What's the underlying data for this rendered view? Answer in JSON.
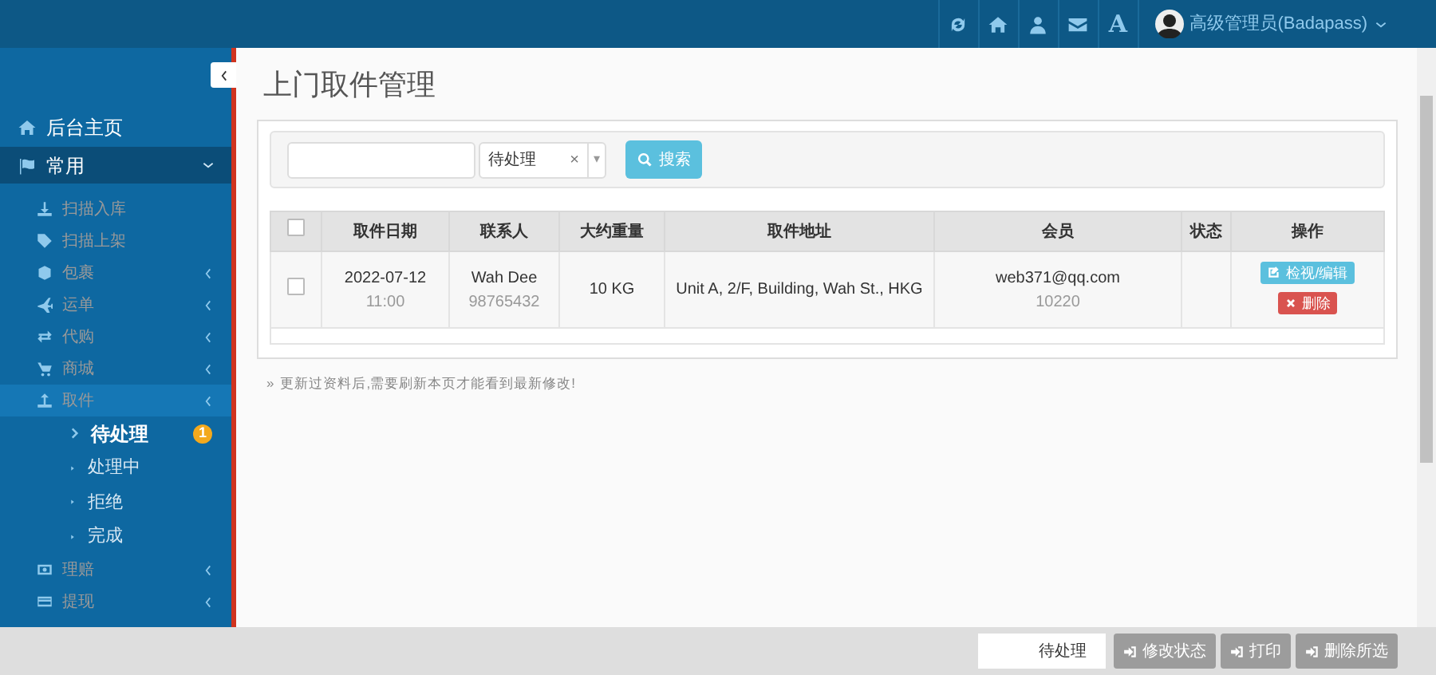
{
  "topbar": {
    "font_glyph": "A",
    "user": "高级管理员(Badapass)"
  },
  "sidebar": {
    "items": [
      {
        "label": "后台主页",
        "kind": "main"
      },
      {
        "label": "常用",
        "kind": "group",
        "children": [
          {
            "label": "扫描入库",
            "kind": "link"
          },
          {
            "label": "扫描上架",
            "kind": "link"
          },
          {
            "label": "包裹",
            "kind": "menu"
          },
          {
            "label": "运单",
            "kind": "menu"
          },
          {
            "label": "代购",
            "kind": "menu"
          },
          {
            "label": "商城",
            "kind": "menu"
          },
          {
            "label": "取件",
            "kind": "menu",
            "active": true,
            "children": [
              {
                "label": "待处理",
                "selected": true,
                "badge": "1"
              },
              {
                "label": "处理中",
                "selected": false
              },
              {
                "label": "拒绝",
                "selected": false
              },
              {
                "label": "完成",
                "selected": false
              }
            ]
          },
          {
            "label": "理赔",
            "kind": "menu"
          },
          {
            "label": "提现",
            "kind": "menu"
          }
        ]
      }
    ]
  },
  "page_title": "上门取件管理",
  "filter": {
    "status": "待处理",
    "clear": "×",
    "caret": "▾",
    "search_button": "搜索"
  },
  "table": {
    "select_all_checked": false,
    "columns": [
      "取件日期",
      "联系人",
      "大约重量",
      "取件地址",
      "会员",
      "状态",
      "操作"
    ],
    "rows": [
      {
        "checked": false,
        "date": "2022-07-12",
        "time": "11:00",
        "contact": "Wah Dee",
        "phone": "98765432",
        "weight": "10 KG",
        "address": "Unit A, 2/F, Building, Wah St., HKG",
        "member": "web371@qq.com",
        "member_id": "10220",
        "edit_button": "检视/编辑",
        "delete_button": "删除"
      }
    ]
  },
  "note_marker": "»",
  "note": "更新过资料后,需要刷新本页才能看到最新修改!",
  "bottom_bar": {
    "status": "待处理",
    "buttons": [
      "修改状态",
      "打印",
      "删除所选"
    ]
  }
}
